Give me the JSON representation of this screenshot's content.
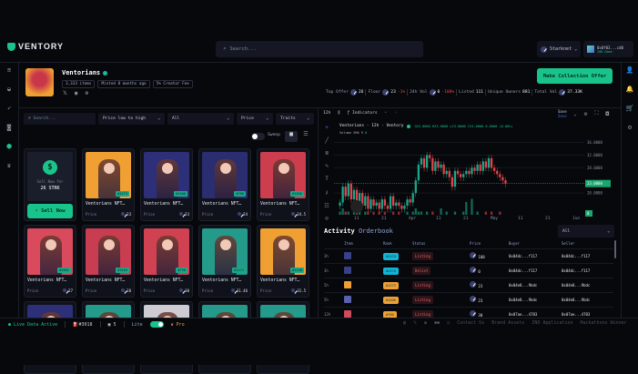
{
  "header": {
    "logo": "VENTORY",
    "search_placeholder": "Search...",
    "network": "Starknet",
    "wallet_address": "0x0f03...cd0",
    "wallet_balance": "208 Gems"
  },
  "collection": {
    "name": "Ventorians",
    "badges": [
      "3,333 items",
      "Minted 8 months ago",
      "5% Creator Fee"
    ],
    "offer_button": "Make Collection Offer",
    "stats": {
      "top_offer_label": "Top Offer",
      "top_offer": "26",
      "floor_label": "Floor",
      "floor": "23",
      "floor_change": "-1%",
      "vol24_label": "24h Vol",
      "vol24": "0",
      "vol24_change": "-100%",
      "listed_label": "Listed",
      "listed": "111",
      "owners_label": "Unique Owners",
      "owners": "881",
      "total_vol_label": "Total Vol",
      "total_vol": "37.33K"
    }
  },
  "filters": {
    "search_placeholder": "Search...",
    "sort": "Price low to high",
    "category": "All",
    "price": "Price",
    "traits": "Traits",
    "sweep": "Sweep"
  },
  "sell": {
    "label": "Sell Now for",
    "amount": "26 STRK",
    "button": "Sell Now"
  },
  "items": [
    {
      "name": "Ventorians NFT…",
      "rank": "#1273",
      "price_label": "Price",
      "price": "23",
      "color": "#f0a032"
    },
    {
      "name": "Ventorians NFT…",
      "rank": "#1408",
      "price_label": "Price",
      "price": "23",
      "color": "#2d2f78"
    },
    {
      "name": "Ventorians NFT…",
      "rank": "#780",
      "price_label": "Price",
      "price": "24",
      "color": "#2a2d70"
    },
    {
      "name": "Ventorians NFT…",
      "rank": "#1836",
      "price_label": "Price",
      "price": "24.5",
      "color": "#cc3d4e"
    },
    {
      "name": "Ventorians NFT…",
      "rank": "#2062",
      "price_label": "Price",
      "price": "27",
      "color": "#d84a5c"
    },
    {
      "name": "Ventorians NFT…",
      "rank": "#3184",
      "price_label": "Price",
      "price": "28",
      "color": "#c93d50"
    },
    {
      "name": "Ventorians NFT…",
      "rank": "#758",
      "price_label": "Price",
      "price": "30",
      "color": "#d04252"
    },
    {
      "name": "Ventorians NFT…",
      "rank": "#1272",
      "price_label": "Price",
      "price": "31.46",
      "color": "#249a8a"
    },
    {
      "name": "Ventorians NFT…",
      "rank": "#1148",
      "price_label": "Price",
      "price": "31.5",
      "color": "#f0a032"
    },
    {
      "color": "#2d2f78"
    },
    {
      "color": "#249a8a"
    },
    {
      "color": "#cfcbd3"
    },
    {
      "color": "#249a8a"
    },
    {
      "color": "#249a8a"
    }
  ],
  "chart_toolbar": {
    "interval": "12h",
    "indicators": "Indicators",
    "save": "Save",
    "save_sub": "Save"
  },
  "chart_data": {
    "type": "candlestick",
    "title": "Ventorians · 12h · Ventory",
    "ohlc": "O23.0000 H23.0000 L23.0000 C23.0000 0.0000 (0.00%)",
    "volume_label": "Volume SMA 9",
    "volume_value": "0",
    "y_ticks": [
      "36.0000",
      "32.0000",
      "28.0000",
      "20.0000"
    ],
    "last_price": "23.0000",
    "vol_tag": "0",
    "ylim": [
      14,
      37
    ],
    "x_ticks": [
      "11",
      "21",
      "Apr",
      "11",
      "21",
      "May",
      "11",
      "21",
      "Jun"
    ],
    "closes": [
      17,
      22,
      19,
      23,
      18,
      21,
      17,
      20,
      16,
      19,
      15,
      18,
      16,
      17,
      15,
      18,
      16,
      15,
      19,
      16,
      17,
      16,
      15,
      16,
      18,
      17,
      20,
      24,
      29,
      31,
      28,
      32,
      31,
      27,
      30,
      28,
      29,
      26,
      27,
      25,
      22,
      27,
      26,
      25,
      26,
      27,
      26,
      28,
      27,
      29,
      27,
      30,
      28,
      31,
      28,
      27,
      26,
      25,
      24,
      23
    ],
    "volumes": [
      1,
      2,
      1,
      1,
      0,
      1,
      2,
      1,
      0,
      1,
      1,
      0,
      1,
      0,
      1,
      0,
      1,
      0,
      0,
      1,
      0,
      1,
      0,
      0,
      1,
      0,
      1,
      2,
      1,
      1,
      0,
      1,
      0,
      1,
      0,
      0,
      2,
      0,
      1,
      0,
      0,
      1,
      0,
      0,
      1,
      4,
      0,
      5,
      0,
      1,
      0,
      0,
      1,
      0,
      1,
      0,
      0,
      1,
      0,
      0
    ]
  },
  "activity": {
    "title": "Activity",
    "tab": "Orderbook",
    "filter": "All",
    "columns": [
      "Item",
      "Rank",
      "Status",
      "Price",
      "Buyer",
      "Seller"
    ],
    "rows": [
      {
        "time": "3h",
        "rank": "#2470",
        "rank_color": "#11b5d4",
        "status": "Listing",
        "price": "100",
        "buyer": "0x04dc...f117",
        "seller": "0x04dc...f117",
        "thumb": "#3a3f8a"
      },
      {
        "time": "3h",
        "rank": "#2470",
        "rank_color": "#11b5d4",
        "status": "Delist",
        "price": "0",
        "buyer": "0x04dc...f117",
        "seller": "0x04dc...f117",
        "thumb": "#3a3f8a"
      },
      {
        "time": "5h",
        "rank": "#1273",
        "rank_color": "#f0a032",
        "status": "Listing",
        "price": "23",
        "buyer": "0x04e8...9bdc",
        "seller": "0x04e8...9bdc",
        "thumb": "#f0a032"
      },
      {
        "time": "5h",
        "rank": "#1408",
        "rank_color": "#f0a032",
        "status": "Listing",
        "price": "23",
        "buyer": "0x04e8...9bdc",
        "seller": "0x04e8...9bdc",
        "thumb": "#5a60b0"
      },
      {
        "time": "12h",
        "rank": "#780",
        "rank_color": "#f0a032",
        "status": "Listing",
        "price": "30",
        "buyer": "0x07ae...4783",
        "seller": "0x07ae...4783",
        "thumb": "#d04a5c"
      }
    ]
  },
  "footer": {
    "live": "Live Data Active",
    "gas": "#3018",
    "count": "5",
    "lite": "Lite",
    "pro": "Pro",
    "links": [
      "Contact Us",
      "Brand Assets",
      "INO Application",
      "Hackathons Winner"
    ]
  }
}
